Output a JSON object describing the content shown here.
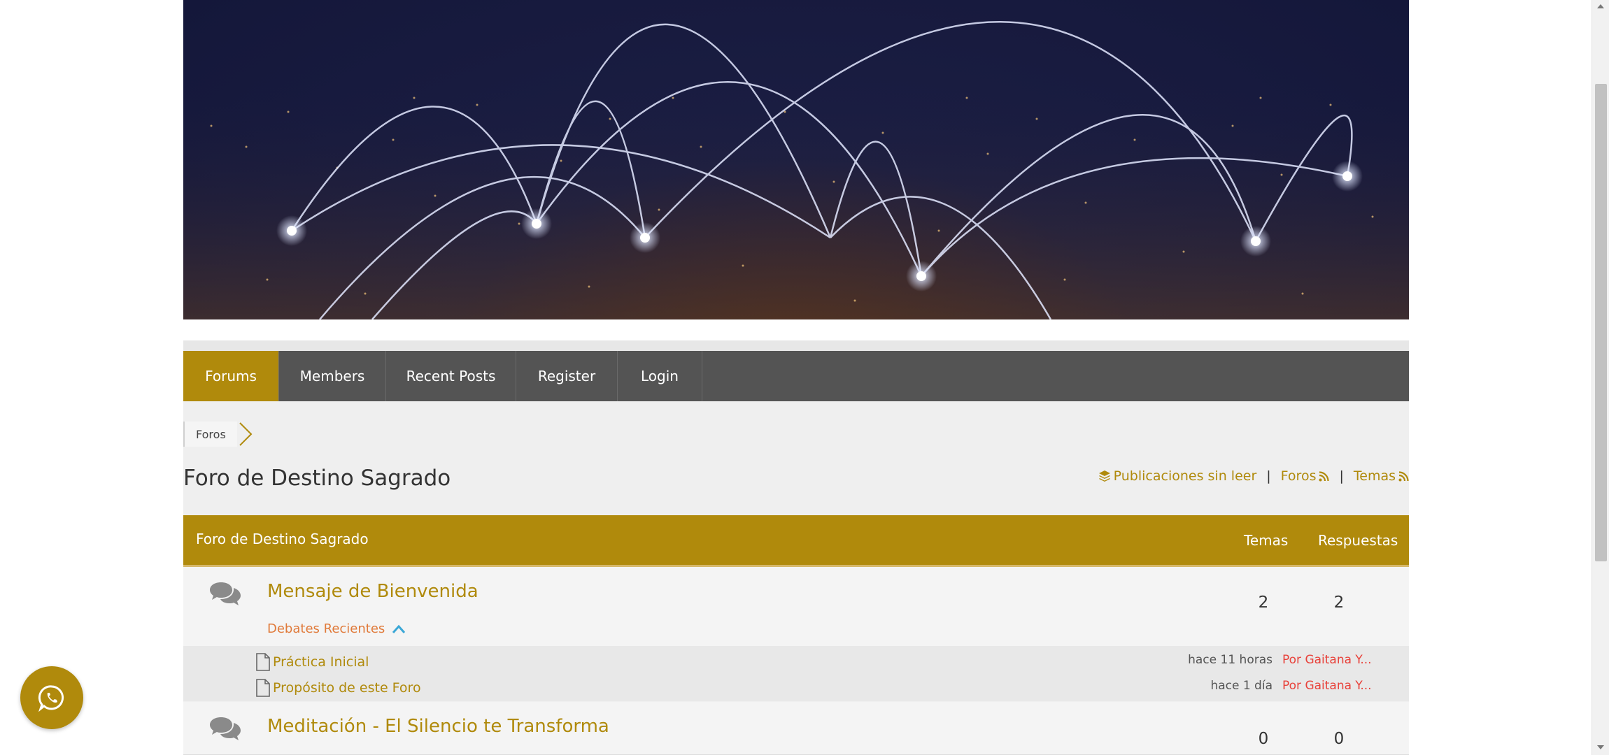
{
  "nav": {
    "items": [
      {
        "label": "Forums",
        "active": true
      },
      {
        "label": "Members",
        "active": false
      },
      {
        "label": "Recent Posts",
        "active": false
      },
      {
        "label": "Register",
        "active": false
      },
      {
        "label": "Login",
        "active": false
      }
    ]
  },
  "breadcrumb": {
    "root": "Foros"
  },
  "page": {
    "title": "Foro de Destino Sagrado",
    "links": {
      "unread": "Publicaciones sin leer",
      "forums": "Foros",
      "topics": "Temas",
      "separator": "|"
    }
  },
  "table": {
    "header_name": "Foro de Destino Sagrado",
    "col_topics": "Temas",
    "col_replies": "Respuestas"
  },
  "forums": [
    {
      "name": "Mensaje de Bienvenida",
      "topics": "2",
      "replies": "2",
      "recent_label": "Debates Recientes",
      "recent": [
        {
          "title": "Práctica Inicial",
          "time": "hace 11 horas",
          "author": "Por Gaitana Y..."
        },
        {
          "title": "Propósito de este Foro",
          "time": "hace 1 día",
          "author": "Por Gaitana Y..."
        }
      ]
    },
    {
      "name": "Meditación - El Silencio te Transforma",
      "topics": "0",
      "replies": "0"
    }
  ],
  "colors": {
    "accent": "#b08a0c",
    "nav_bg": "#545454",
    "author": "#e8413a",
    "recent_toggle": "#e07a3a"
  },
  "icons": {
    "forum": "comments-icon",
    "topic": "file-icon",
    "unread": "layers-icon",
    "rss": "rss-icon",
    "whatsapp": "whatsapp-icon"
  }
}
